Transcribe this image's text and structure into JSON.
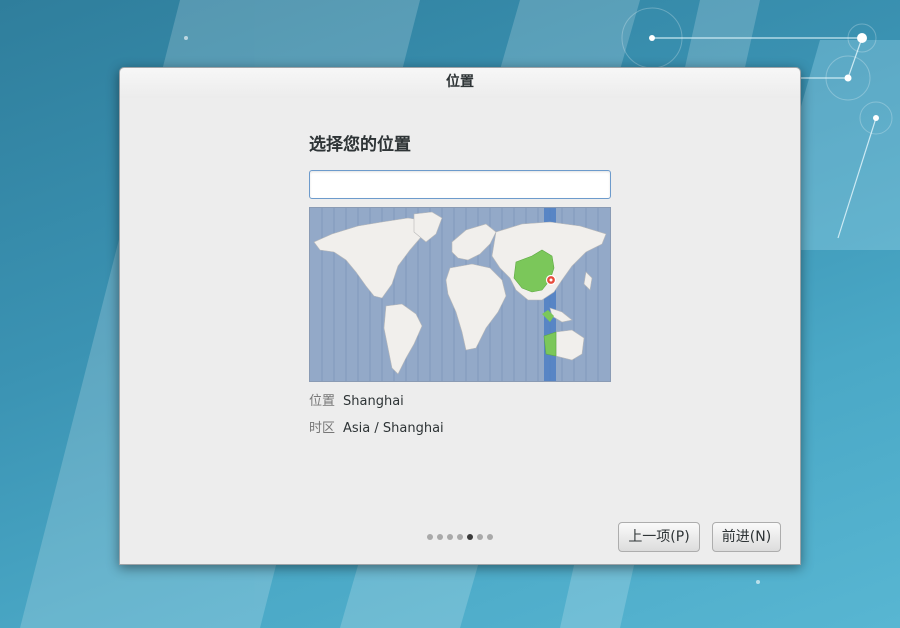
{
  "window": {
    "title": "位置"
  },
  "page": {
    "heading": "选择您的位置",
    "search": {
      "value": "",
      "placeholder": ""
    },
    "map": {
      "selected_city": "Shanghai",
      "highlight_color": "#7bc75a",
      "marker_color": "#e74c3c"
    },
    "details": {
      "location_label": "位置",
      "location_value": "Shanghai",
      "timezone_label": "时区",
      "timezone_value": "Asia / Shanghai"
    }
  },
  "pager": {
    "total": 7,
    "current": 5
  },
  "buttons": {
    "prev": "上一项(P)",
    "next": "前进(N)"
  }
}
